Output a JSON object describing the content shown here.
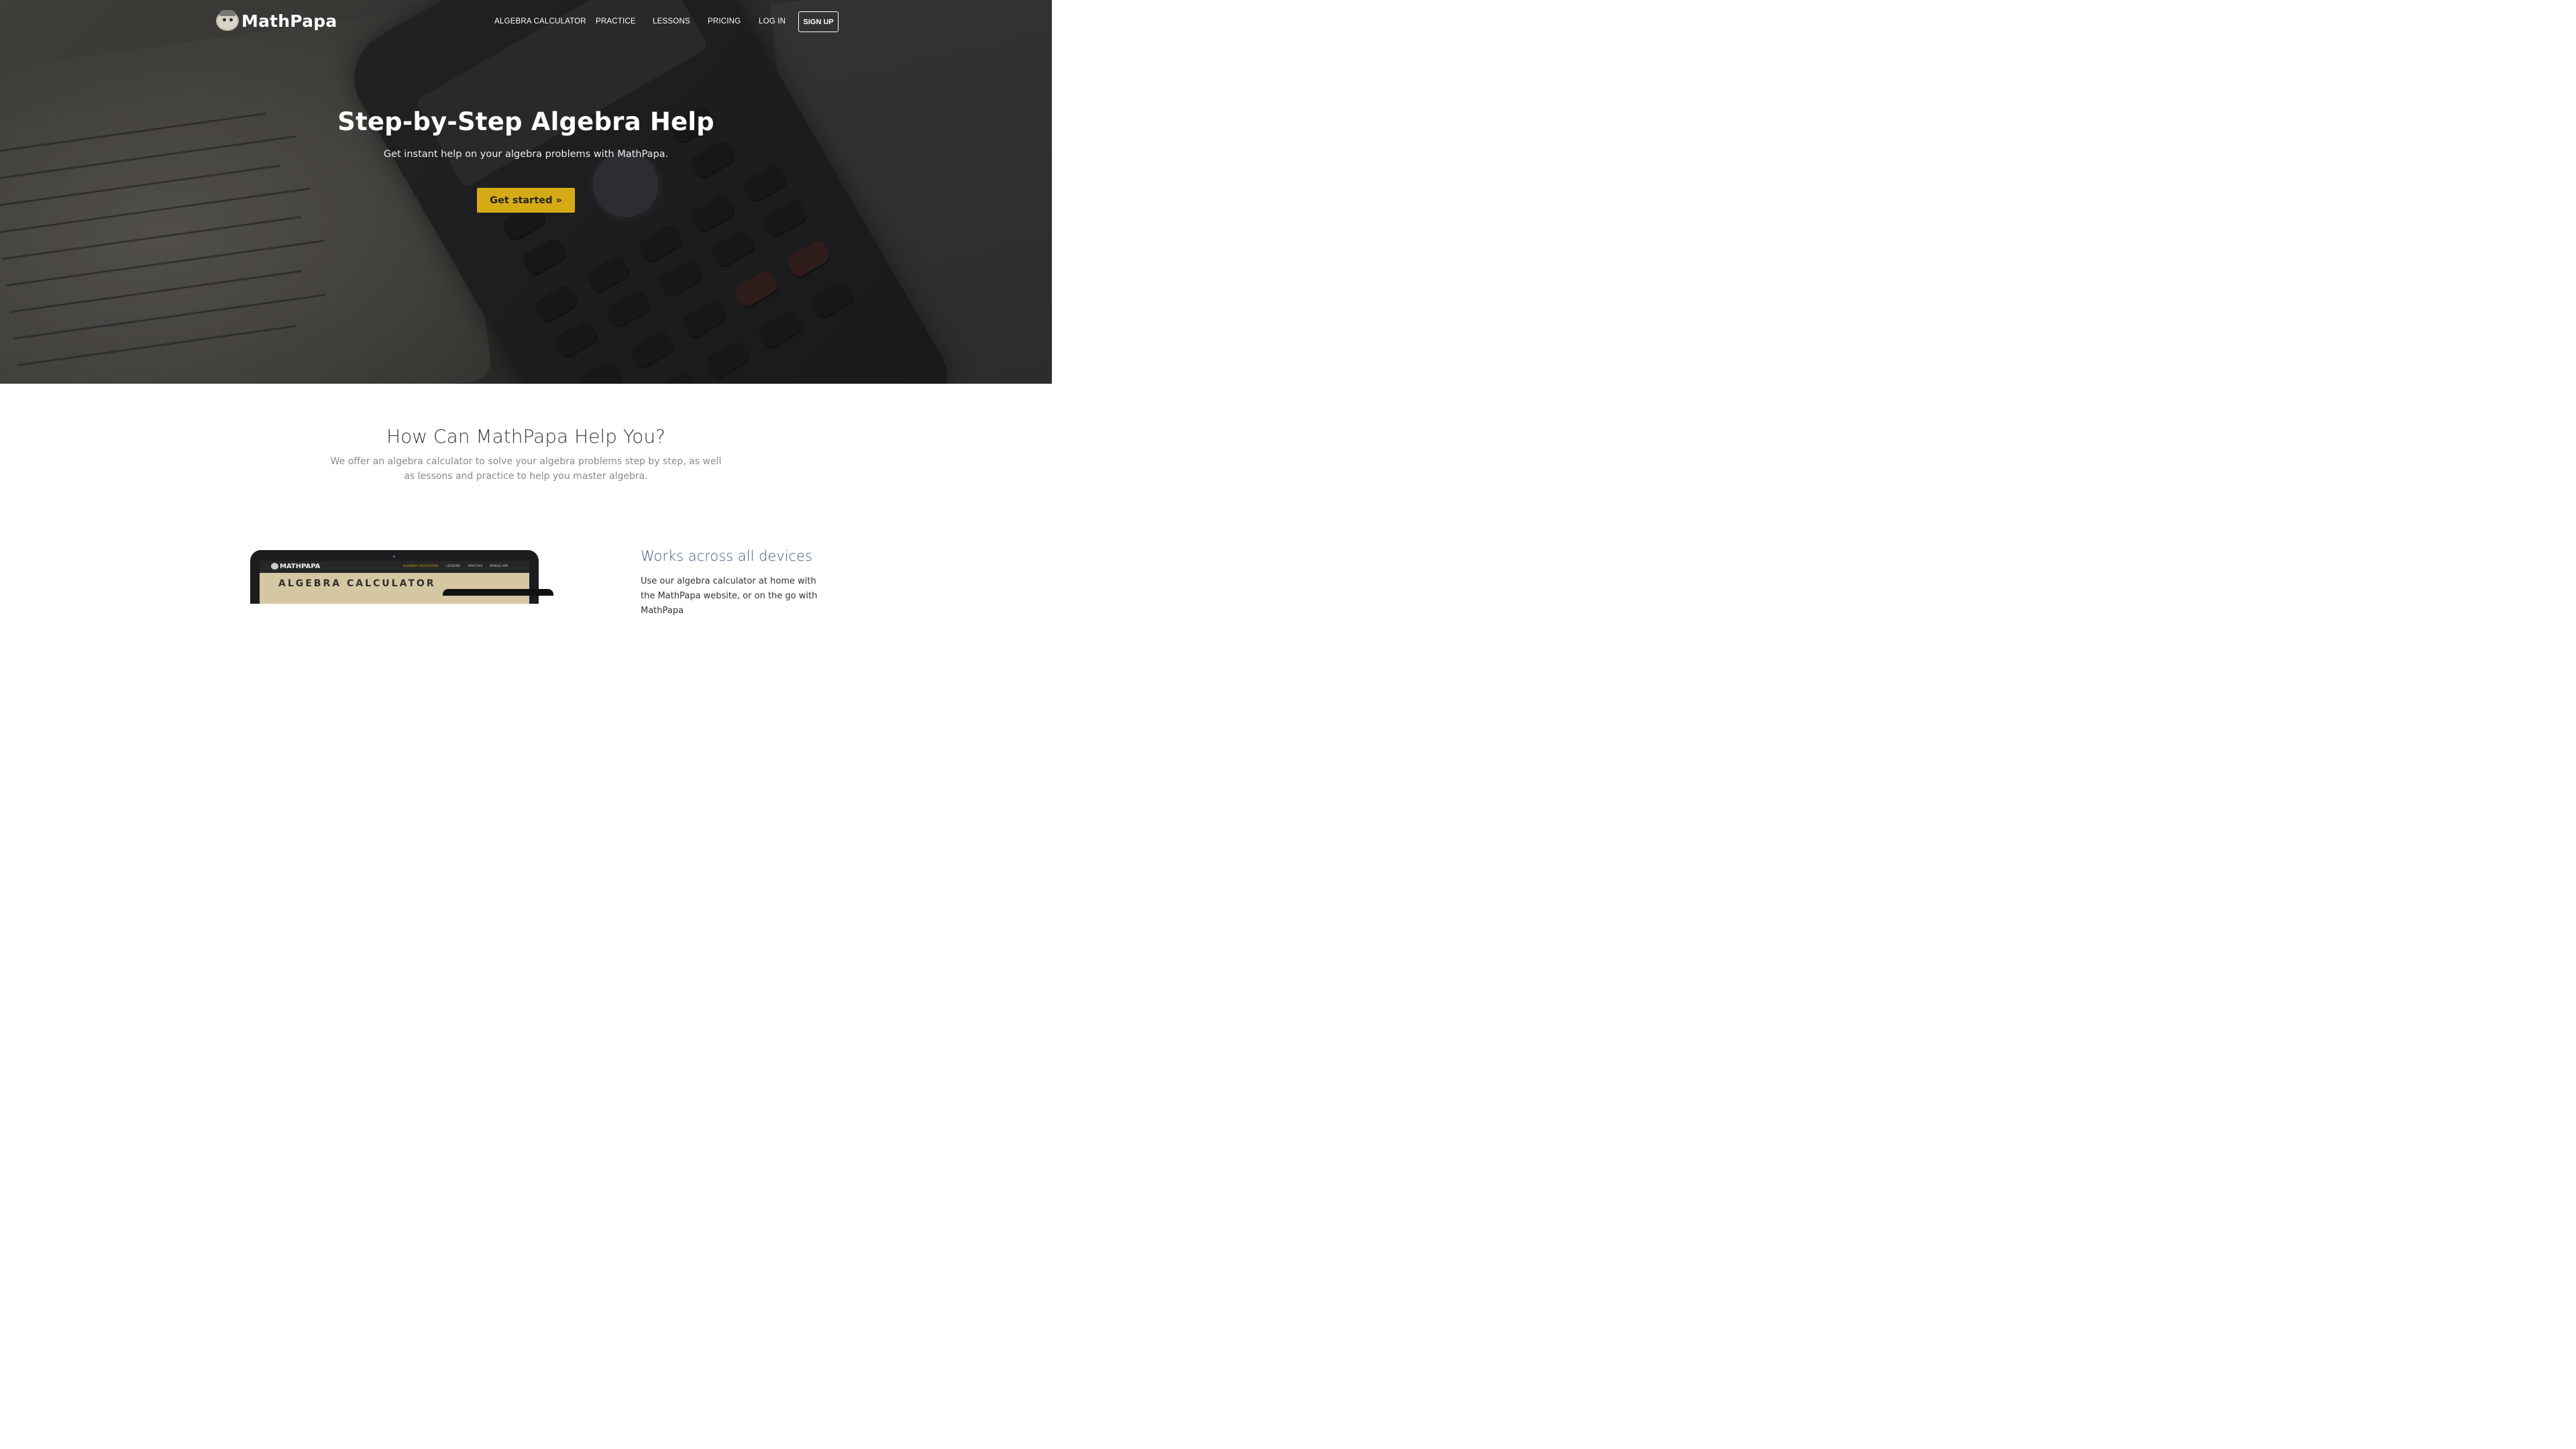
{
  "brand": {
    "name": "MathPapa"
  },
  "nav": {
    "items": [
      {
        "label": "ALGEBRA CALCULATOR"
      },
      {
        "label": "PRACTICE"
      },
      {
        "label": "LESSONS"
      },
      {
        "label": "PRICING"
      },
      {
        "label": "LOG IN"
      }
    ],
    "signup_label": "SIGN UP"
  },
  "hero": {
    "title": "Step-by-Step Algebra Help",
    "subtitle": "Get instant help on your algebra problems with MathPapa.",
    "cta_label": "Get started »"
  },
  "help_section": {
    "title": "How Can MathPapa Help You?",
    "description": "We offer an algebra calculator to solve your algebra problems step by step, as well as lessons and practice to help you master algebra."
  },
  "device_mockup": {
    "logo": "MATHPAPA",
    "nav": [
      "ALGEBRA CALCULATOR",
      "LESSONS",
      "PRACTICE",
      "MOBILE APP"
    ],
    "banner_title": "ALGEBRA CALCULATOR"
  },
  "feature": {
    "title": "Works across all devices",
    "text": "Use our algebra calculator at home with the MathPapa website, or on the go with MathPapa"
  },
  "colors": {
    "cta": "#d5ab15",
    "feature_title": "#3d5a86",
    "hero_overlay": "rgba(25,25,25,0.55)"
  }
}
